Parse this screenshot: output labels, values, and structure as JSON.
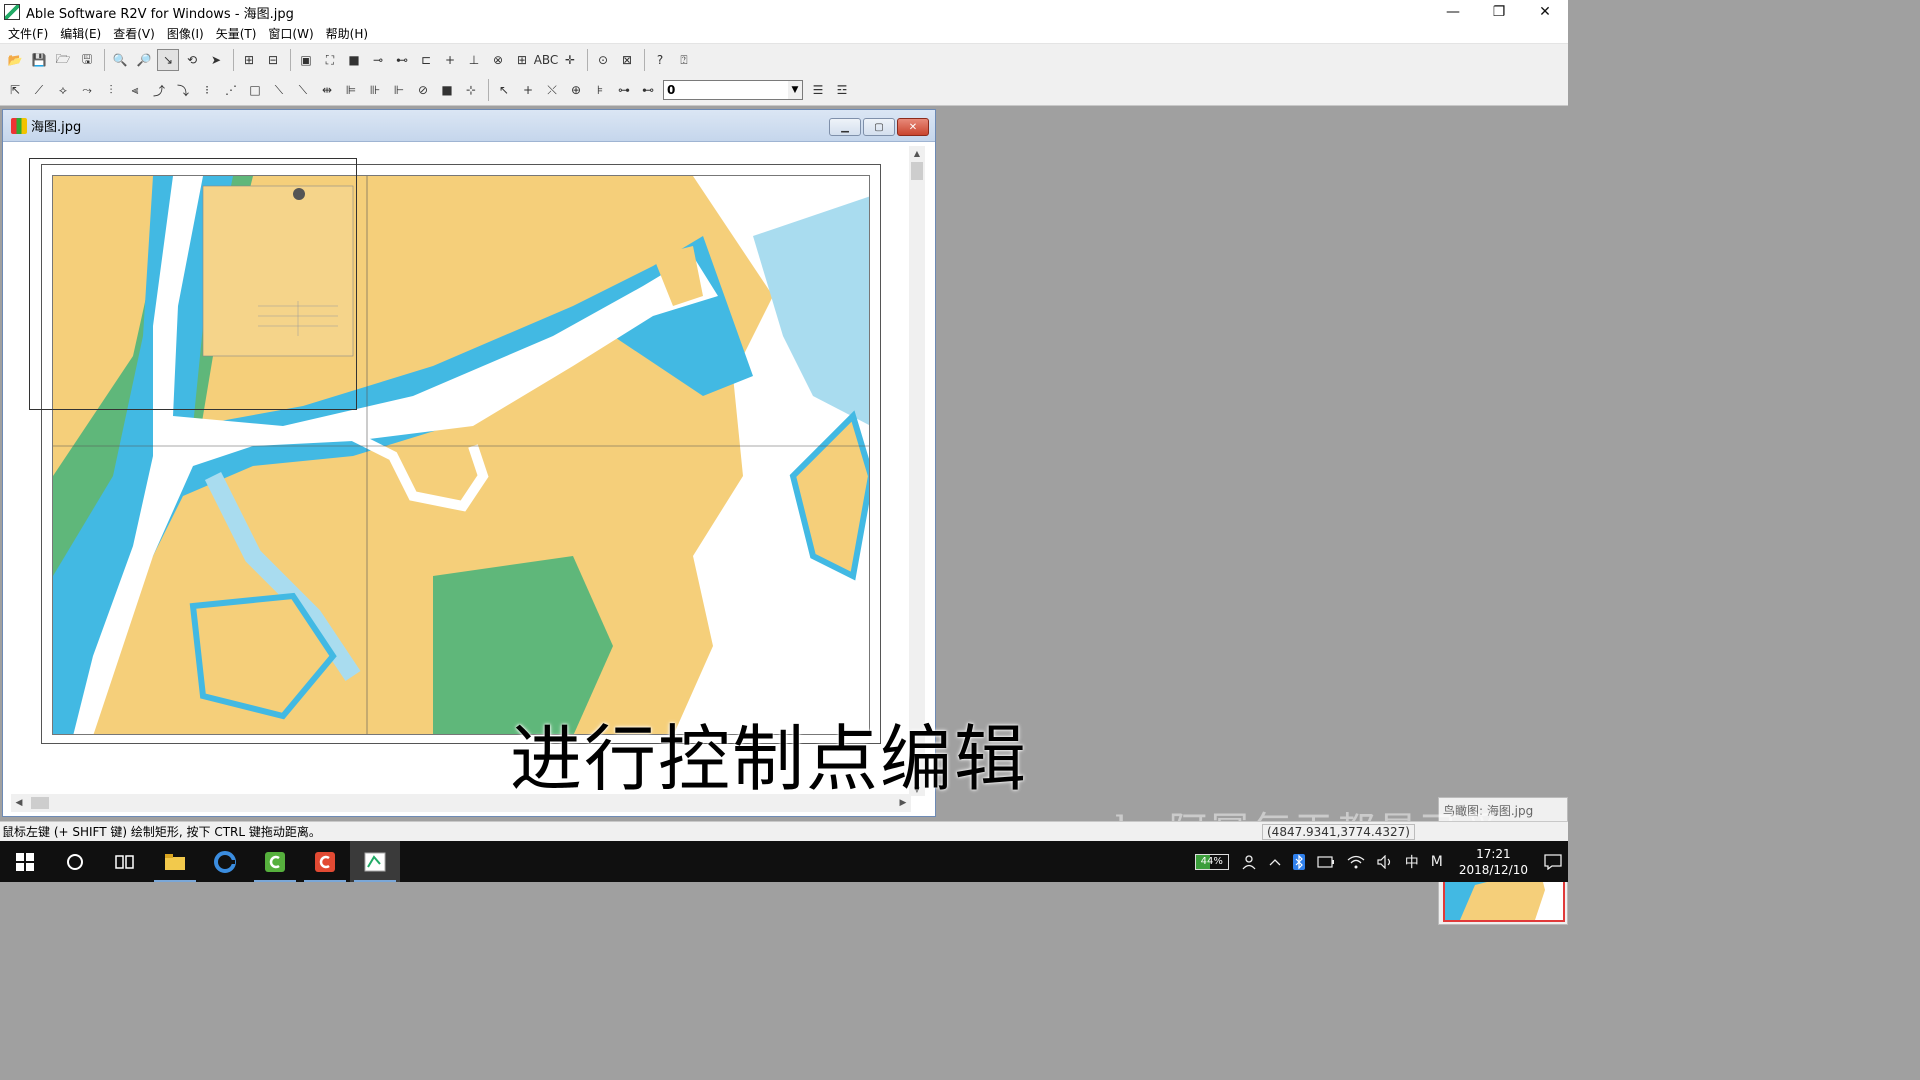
{
  "window": {
    "title": "Able Software R2V for Windows - 海图.jpg",
    "minimize": "—",
    "restore": "❐",
    "close": "✕"
  },
  "menu": [
    "文件(F)",
    "编辑(E)",
    "查看(V)",
    "图像(I)",
    "矢量(T)",
    "窗口(W)",
    "帮助(H)"
  ],
  "toolbar1": [
    "📂",
    "💾",
    "🗁",
    "🖫",
    "🔍",
    "🔎",
    "↘",
    "⟲",
    "➤",
    "⊞",
    "⊟",
    "▣",
    "⛶",
    "■",
    "⊸",
    "⊷",
    "⊏",
    "+",
    "⊥",
    "⊗",
    "⊞",
    "ABC",
    "✛",
    "⊙",
    "⊠",
    "?",
    "⍰"
  ],
  "toolbar2": [
    "⇱",
    "⟋",
    "⟡",
    "⤳",
    "⫶",
    "⫷",
    "⤴",
    "⤵",
    "⁝",
    "⋰",
    "□",
    "⟍",
    "⟍",
    "⇹",
    "⊫",
    "⊪",
    "⊩",
    "⊘",
    "■",
    "⊹",
    "↖",
    "+",
    "⤬",
    "⊕",
    "⊧",
    "⊶",
    "⊷"
  ],
  "layer_select": {
    "value": "0",
    "arrow": "▼"
  },
  "toolbar2_tail": [
    "☰",
    "☲"
  ],
  "child": {
    "title": "海图.jpg",
    "min": "▁",
    "max": "▢",
    "close": "✕"
  },
  "subtitle": "进行控制点编辑",
  "watermark": "by阿幂每天都是可爱",
  "birdseye": {
    "title": "鸟瞰图: 海图.jpg"
  },
  "status": {
    "hint": "鼠标左键 (+ SHIFT 键) 绘制矩形, 按下 CTRL 键拖动距离。",
    "coords": "(4847.9341,3774.4327)"
  },
  "taskbar": {
    "battery": "44%",
    "ime": "中",
    "ime2": "M",
    "time": "17:21",
    "date": "2018/12/10"
  },
  "colors": {
    "land": "#f5cf7a",
    "sea_shallow": "#42b9e3",
    "sea_light": "#a9dcef",
    "wetland": "#5fb77a",
    "water": "#ffffff"
  }
}
